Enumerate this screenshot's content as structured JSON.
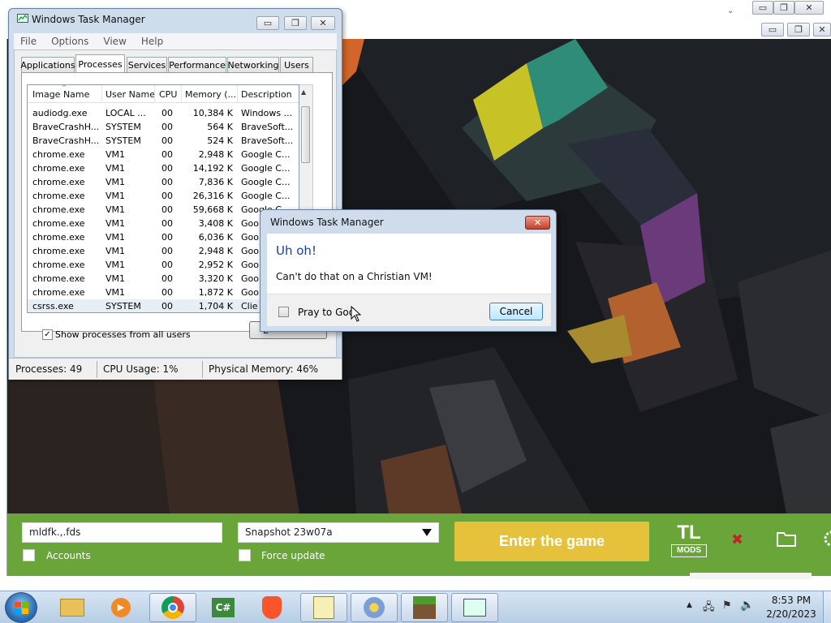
{
  "task_manager": {
    "title": "Windows Task Manager",
    "menu": [
      "File",
      "Options",
      "View",
      "Help"
    ],
    "tabs": [
      "Applications",
      "Processes",
      "Services",
      "Performance",
      "Networking",
      "Users"
    ],
    "active_tab": "Processes",
    "columns": [
      "Image Name",
      "User Name",
      "CPU",
      "Memory (...",
      "Description"
    ],
    "rows": [
      [
        "audiodg.exe",
        "LOCAL ...",
        "00",
        "10,384 K",
        "Windows ..."
      ],
      [
        "BraveCrashH...",
        "SYSTEM",
        "00",
        "564 K",
        "BraveSoft..."
      ],
      [
        "BraveCrashH...",
        "SYSTEM",
        "00",
        "524 K",
        "BraveSoft..."
      ],
      [
        "chrome.exe",
        "VM1",
        "00",
        "2,948 K",
        "Google C..."
      ],
      [
        "chrome.exe",
        "VM1",
        "00",
        "14,192 K",
        "Google C..."
      ],
      [
        "chrome.exe",
        "VM1",
        "00",
        "7,836 K",
        "Google C..."
      ],
      [
        "chrome.exe",
        "VM1",
        "00",
        "26,316 K",
        "Google C..."
      ],
      [
        "chrome.exe",
        "VM1",
        "00",
        "59,668 K",
        "Google C..."
      ],
      [
        "chrome.exe",
        "VM1",
        "00",
        "3,408 K",
        "Goo"
      ],
      [
        "chrome.exe",
        "VM1",
        "00",
        "6,036 K",
        "Goo"
      ],
      [
        "chrome.exe",
        "VM1",
        "00",
        "2,948 K",
        "Goo"
      ],
      [
        "chrome.exe",
        "VM1",
        "00",
        "2,952 K",
        "Goo"
      ],
      [
        "chrome.exe",
        "VM1",
        "00",
        "3,320 K",
        "Goo"
      ],
      [
        "chrome.exe",
        "VM1",
        "00",
        "1,872 K",
        "Goo"
      ],
      [
        "csrss.exe",
        "SYSTEM",
        "00",
        "1,704 K",
        "Clie"
      ]
    ],
    "show_all_label": "Show processes from all users",
    "show_all_checked": true,
    "end_button_label": "E",
    "status": {
      "processes": "Processes: 49",
      "cpu": "CPU Usage: 1%",
      "memory": "Physical Memory: 46%"
    }
  },
  "dialog": {
    "title": "Windows Task Manager",
    "heading": "Uh oh!",
    "message": "Can't do that on a Christian VM!",
    "checkbox_label": "Pray to God",
    "cancel_label": "Cancel",
    "close_glyph": "✕"
  },
  "launcher": {
    "username": "mldfk.,.fds",
    "version": "Snapshot 23w07a",
    "accounts_label": "Accounts",
    "force_update_label": "Force update",
    "enter_label": "Enter the game",
    "logo_top": "TL",
    "logo_bottom": "MODS"
  },
  "taskbar": {
    "time": "8:53 PM",
    "date": "2/20/2023",
    "apps": [
      "explorer-icon",
      "media-player-icon",
      "chrome-icon",
      "csharp-icon",
      "brave-icon",
      "notepad-icon",
      "paint-icon",
      "minecraft-icon",
      "task-manager-icon"
    ]
  },
  "window_controls": {
    "minimize": "▭",
    "maximize": "❐",
    "close": "✕"
  },
  "colors": {
    "launcher_green": "#6aa53a",
    "enter_yellow": "#e6c13c",
    "dialog_heading_blue": "#1b3f94"
  }
}
